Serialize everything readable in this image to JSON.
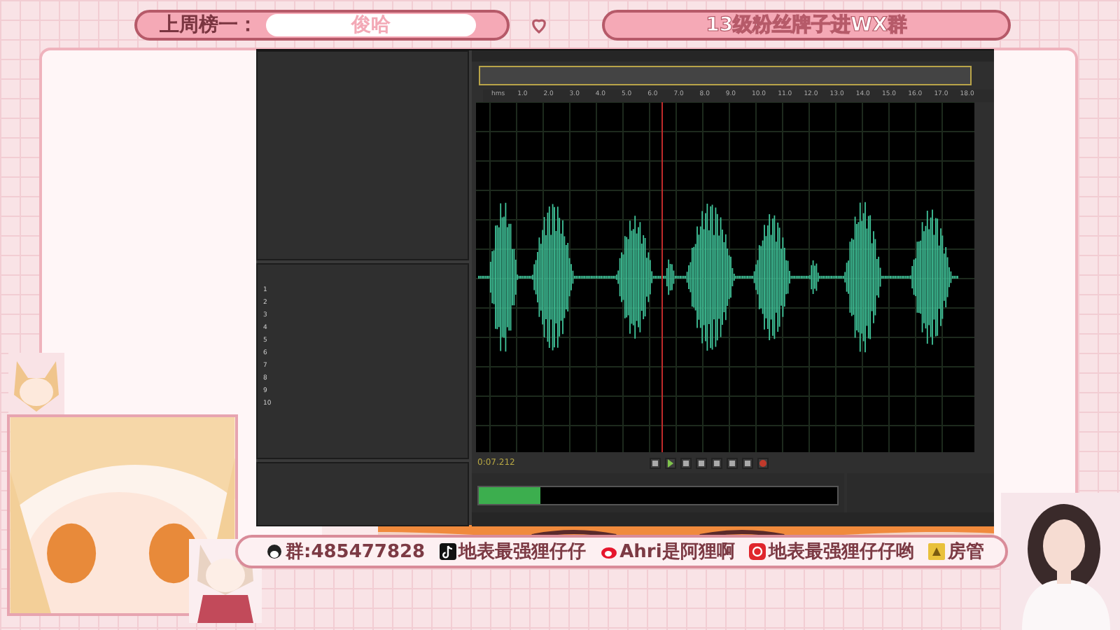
{
  "header": {
    "ranking_label": "上周榜一：",
    "ranking_name": "俊哈",
    "group_banner": "13级粉丝牌子进WX群"
  },
  "editor": {
    "ruler": [
      "hms",
      "1.0",
      "2.0",
      "3.0",
      "4.0",
      "5.0",
      "6.0",
      "7.0",
      "8.0",
      "9.0",
      "10.0",
      "11.0",
      "12.0",
      "13.0",
      "14.0",
      "15.0",
      "16.0",
      "17.0",
      "18.0"
    ],
    "time": "0:07.212",
    "effects_slots": [
      "1",
      "2",
      "3",
      "4",
      "5",
      "6",
      "7",
      "8",
      "9",
      "10"
    ]
  },
  "footer": {
    "items": [
      {
        "kind": "qq",
        "text": "群:485477828"
      },
      {
        "kind": "tiktok",
        "text": "地表最强狸仔仔"
      },
      {
        "kind": "weibo",
        "text": "Ahri是阿狸啊"
      },
      {
        "kind": "netease",
        "text": "地表最强狸仔仔哟"
      },
      {
        "kind": "badge",
        "text": "房管"
      }
    ]
  }
}
